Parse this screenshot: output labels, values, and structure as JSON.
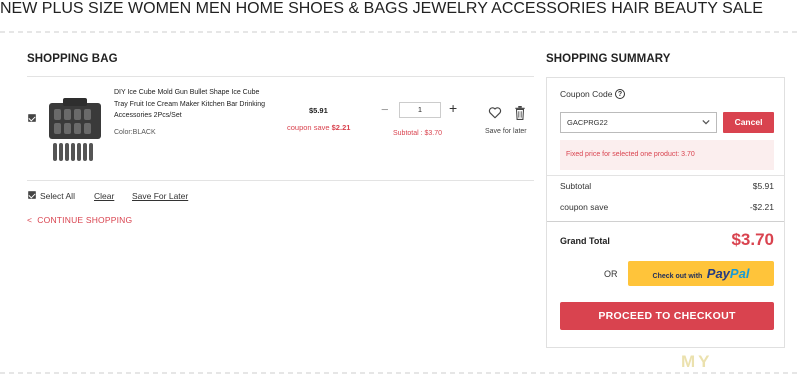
{
  "nav": {
    "items": [
      "NEW",
      "PLUS SIZE",
      "WOMEN",
      "MEN",
      "HOME",
      "SHOES & BAGS",
      "JEWELRY",
      "ACCESSORIES",
      "HAIR",
      "BEAUTY",
      "SALE"
    ]
  },
  "bag": {
    "title": "SHOPPING BAG",
    "item": {
      "name": "DIY Ice Cube Mold Gun Bullet Shape Ice Cube Tray Fruit Ice Cream Maker Kitchen Bar Drinking Accessories 2Pcs/Set",
      "color": "Color:BLACK",
      "price": "$5.91",
      "coupon_label": "coupon save",
      "coupon_value": "$2.21",
      "qty_minus": "−",
      "qty": "1",
      "qty_plus": "+",
      "subtotal": "Subtotal  : $3.70",
      "save_later": "Save for later",
      "checked": true
    },
    "select_all": "Select All",
    "clear": "Clear",
    "save_for_later": "Save For Later",
    "continue": "CONTINUE SHOPPING",
    "continue_arrow": "<"
  },
  "summary": {
    "title": "SHOPPING SUMMARY",
    "coupon_label": "Coupon Code",
    "help": "?",
    "coupon_value": "GACPRG22",
    "cancel": "Cancel",
    "note": "Fixed price for selected one product: 3.70",
    "subtotal_label": "Subtotal",
    "subtotal_value": "$5.91",
    "coupon_save_label": "coupon save",
    "coupon_save_value": "-$2.21",
    "grand_label": "Grand Total",
    "grand_value": "$3.70",
    "or": "OR",
    "paypal_prefix": "Check out with",
    "paypal_pay": "Pay",
    "paypal_pal": "Pal",
    "checkout": "PROCEED TO CHECKOUT"
  },
  "watermark": "MY",
  "colors": {
    "accent": "#d9434f",
    "paypal_bg": "#ffc43a",
    "paypal_dark": "#253b80",
    "paypal_light": "#179bd7"
  }
}
